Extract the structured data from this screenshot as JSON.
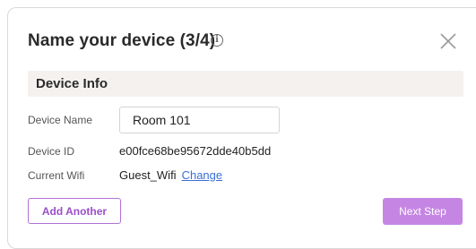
{
  "dialog": {
    "title": "Name your device (3/4)",
    "info_icon": "info-icon",
    "close_icon": "close-icon"
  },
  "section": {
    "title": "Device Info"
  },
  "fields": {
    "device_name_label": "Device Name",
    "device_name_value": "Room 101",
    "device_id_label": "Device ID",
    "device_id_value": "e00fce68be95672dde40b5dd",
    "wifi_label": "Current Wifi",
    "wifi_value": "Guest_Wifi",
    "wifi_change_link": "Change"
  },
  "actions": {
    "add_another_label": "Add Another",
    "next_step_label": "Next Step"
  },
  "colors": {
    "accent": "#b072d6",
    "accent_fill": "#c586e3",
    "link": "#3a6fd8",
    "section_bg": "#f4f1ef"
  }
}
